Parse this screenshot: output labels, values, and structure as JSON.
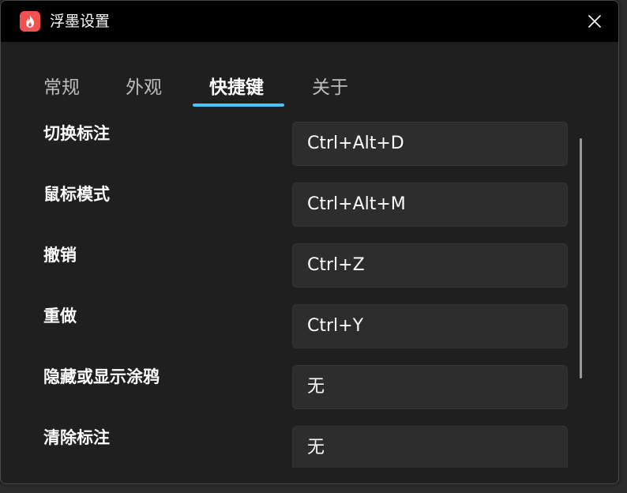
{
  "window": {
    "title": "浮墨设置"
  },
  "tabs": [
    {
      "label": "常规"
    },
    {
      "label": "外观"
    },
    {
      "label": "快捷键"
    },
    {
      "label": "关于"
    }
  ],
  "shortcuts": [
    {
      "label": "切换标注",
      "value": "Ctrl+Alt+D"
    },
    {
      "label": "鼠标模式",
      "value": "Ctrl+Alt+M"
    },
    {
      "label": "撤销",
      "value": "Ctrl+Z"
    },
    {
      "label": "重做",
      "value": "Ctrl+Y"
    },
    {
      "label": "隐藏或显示涂鸦",
      "value": "无"
    },
    {
      "label": "清除标注",
      "value": "无"
    }
  ],
  "icons": {
    "app": "flame-icon",
    "close": "close-icon"
  },
  "colors": {
    "accent": "#4cc2ff",
    "app_icon": "#f0524f",
    "window_bg": "#1f1f1f",
    "titlebar_bg": "#000000",
    "field_bg": "#2d2d2d"
  }
}
